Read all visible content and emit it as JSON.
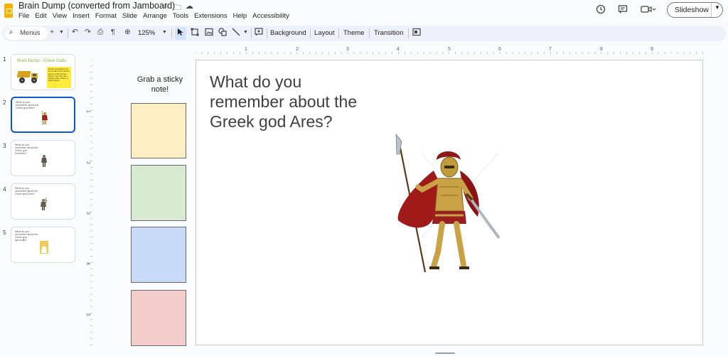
{
  "header": {
    "doc_title": "Brain Dump (converted from Jamboard)",
    "menu": [
      "File",
      "Edit",
      "View",
      "Insert",
      "Format",
      "Slide",
      "Arrange",
      "Tools",
      "Extensions",
      "Help",
      "Accessibility"
    ],
    "slideshow_label": "Slideshow"
  },
  "toolbar": {
    "menus_label": "Menus",
    "zoom": "125%",
    "background_label": "Background",
    "layout_label": "Layout",
    "theme_label": "Theme",
    "transition_label": "Transition"
  },
  "filmstrip": {
    "slides": [
      {
        "number": "1",
        "title": "Brain Dump - Greek Gods",
        "note": "Dump everything you know about the Greek gods on the frames below. You can use sticky notes, draw, or add images."
      },
      {
        "number": "2",
        "title": "What do you remember about the Greek god Ares?"
      },
      {
        "number": "3",
        "title": "What do you remember about the Greek god Poseidon?"
      },
      {
        "number": "4",
        "title": "What do you remember about the Greek god Zeus?"
      },
      {
        "number": "5",
        "title": "What do you remember about the Greek god Aphrodite?"
      }
    ]
  },
  "ruler": {
    "h_labels": [
      "1",
      "2",
      "3",
      "4",
      "5",
      "6",
      "7",
      "8",
      "9"
    ],
    "v_labels": [
      "1",
      "2",
      "3",
      "4",
      "5"
    ]
  },
  "sticky_panel": {
    "label": "Grab a sticky note!",
    "notes": [
      {
        "color": "#fdefc3"
      },
      {
        "color": "#d9ead3"
      },
      {
        "color": "#c9daf8"
      },
      {
        "color": "#f4cccc"
      }
    ]
  },
  "slide": {
    "title": "What do you remember about the Greek god Ares?",
    "image": "spartan-warrior-illustration"
  },
  "colors": {
    "accent": "#0b57d0",
    "toolbar_bg": "#edf2fa",
    "logo": "#f5b400"
  }
}
